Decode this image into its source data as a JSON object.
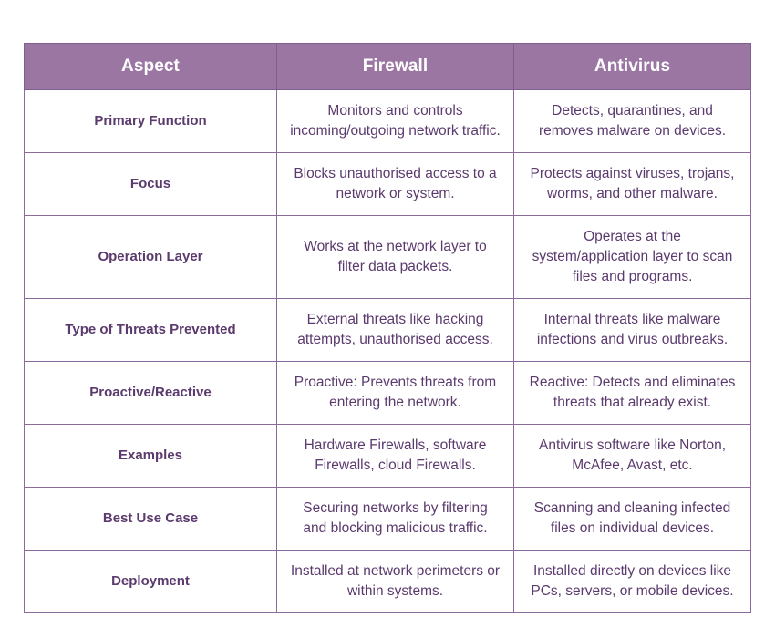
{
  "table": {
    "headers": [
      {
        "label": "Aspect"
      },
      {
        "label": "Firewall"
      },
      {
        "label": "Antivirus"
      }
    ],
    "rows": [
      {
        "aspect": "Primary Function",
        "firewall": "Monitors and controls incoming/outgoing network traffic.",
        "antivirus": "Detects, quarantines, and removes malware on devices."
      },
      {
        "aspect": "Focus",
        "firewall": "Blocks unauthorised access to a network or system.",
        "antivirus": "Protects against viruses, trojans, worms, and other malware."
      },
      {
        "aspect": "Operation Layer",
        "firewall": "Works at the network layer to filter data packets.",
        "antivirus": "Operates at the system/application layer to scan files and programs."
      },
      {
        "aspect": "Type of Threats Prevented",
        "firewall": "External threats like hacking attempts, unauthorised access.",
        "antivirus": "Internal threats like malware infections and virus outbreaks."
      },
      {
        "aspect": "Proactive/Reactive",
        "firewall": "Proactive: Prevents threats from entering the network.",
        "antivirus": "Reactive: Detects and eliminates threats that already exist."
      },
      {
        "aspect": "Examples",
        "firewall": "Hardware Firewalls, software Firewalls, cloud Firewalls.",
        "antivirus": "Antivirus software like Norton, McAfee, Avast, etc."
      },
      {
        "aspect": "Best Use Case",
        "firewall": "Securing networks by filtering and blocking malicious traffic.",
        "antivirus": "Scanning and cleaning infected files on individual devices."
      },
      {
        "aspect": "Deployment",
        "firewall": "Installed at network perimeters or within systems.",
        "antivirus": "Installed directly on devices like PCs, servers, or mobile devices."
      }
    ]
  },
  "colors": {
    "header_background": "#9b76a3",
    "header_text": "#ffffff",
    "border": "#8a6b9c",
    "body_text": "#5b3a6e",
    "page_background": "#ffffff"
  }
}
